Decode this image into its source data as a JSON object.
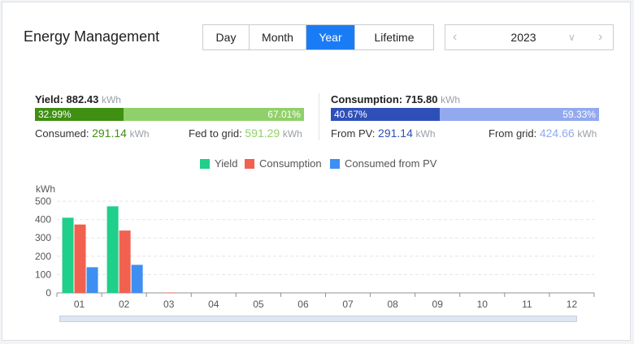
{
  "header": {
    "title": "Energy Management",
    "tabs": [
      {
        "label": "Day",
        "active": false
      },
      {
        "label": "Month",
        "active": false
      },
      {
        "label": "Year",
        "active": true
      },
      {
        "label": "Lifetime",
        "active": false
      }
    ],
    "year_selector": {
      "value": "2023",
      "prev_icon": "chevron-left-icon",
      "dropdown_icon": "chevron-down-icon",
      "next_icon": "chevron-right-icon"
    }
  },
  "yield": {
    "label": "Yield:",
    "value": "882.43",
    "unit": "kWh",
    "consumed_pct": 32.99,
    "fed_pct": 67.01,
    "consumed_pct_label": "32.99%",
    "fed_pct_label": "67.01%",
    "consumed_label": "Consumed:",
    "consumed_value": "291.14",
    "consumed_unit": "kWh",
    "fed_label": "Fed to grid:",
    "fed_value": "591.29",
    "fed_unit": "kWh",
    "colors": {
      "dark": "#3f8f12",
      "light": "#90d06a"
    }
  },
  "consumption": {
    "label": "Consumption:",
    "value": "715.80",
    "unit": "kWh",
    "pv_pct": 40.67,
    "grid_pct": 59.33,
    "pv_pct_label": "40.67%",
    "grid_pct_label": "59.33%",
    "pv_label": "From PV:",
    "pv_value": "291.14",
    "pv_unit": "kWh",
    "grid_label": "From grid:",
    "grid_value": "424.66",
    "grid_unit": "kWh",
    "colors": {
      "dark": "#2f4fb8",
      "light": "#93a9ef"
    }
  },
  "chart_data": {
    "type": "bar",
    "ylabel": "kWh",
    "ylim": [
      0,
      500
    ],
    "yticks": [
      0,
      100,
      200,
      300,
      400,
      500
    ],
    "grid": true,
    "legend_position": "top-center",
    "categories": [
      "01",
      "02",
      "03",
      "04",
      "05",
      "06",
      "07",
      "08",
      "09",
      "10",
      "11",
      "12"
    ],
    "series": [
      {
        "name": "Yield",
        "color": "#1fcf8a",
        "values": [
          410,
          472,
          0,
          0,
          0,
          0,
          0,
          0,
          0,
          0,
          0,
          0
        ]
      },
      {
        "name": "Consumption",
        "color": "#f2604f",
        "values": [
          373,
          340,
          2,
          0,
          0,
          0,
          0,
          0,
          0,
          0,
          0,
          0
        ]
      },
      {
        "name": "Consumed from PV",
        "color": "#3e8ff1",
        "values": [
          140,
          153,
          0,
          0,
          0,
          0,
          0,
          0,
          0,
          0,
          0,
          0
        ]
      }
    ]
  }
}
